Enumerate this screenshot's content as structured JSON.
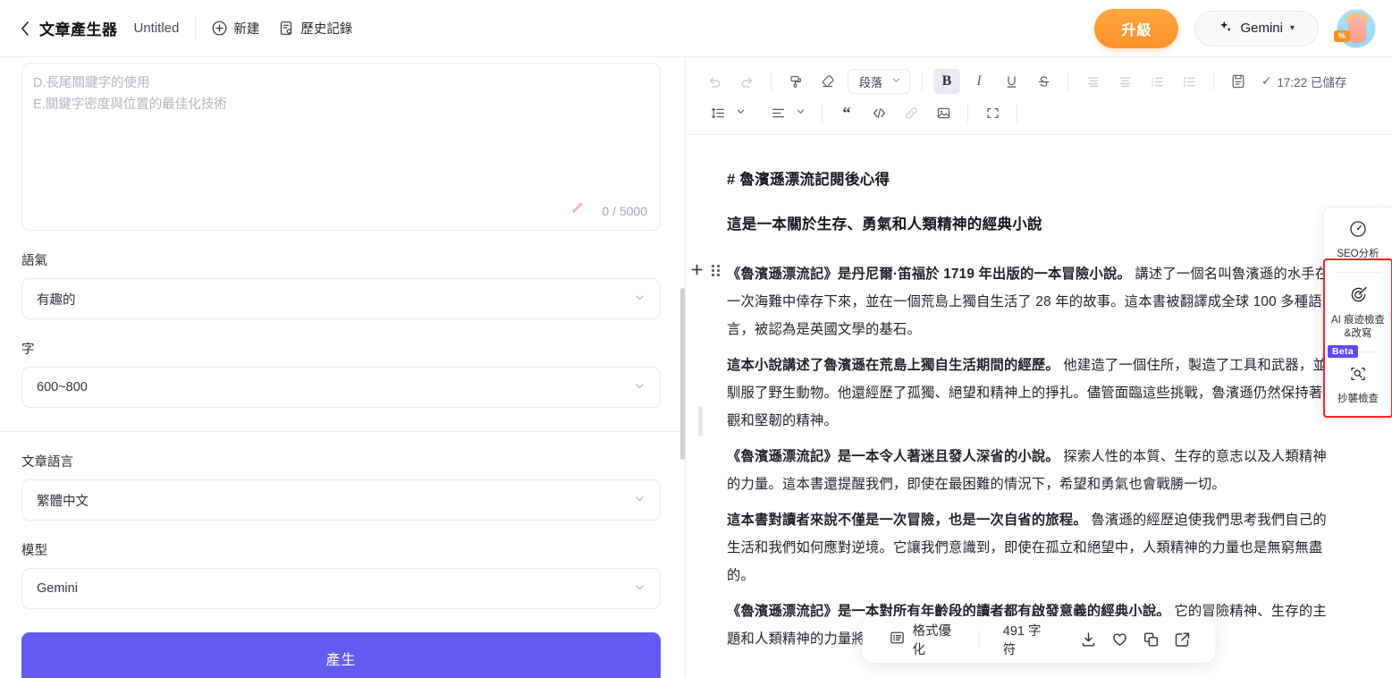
{
  "topbar": {
    "back_icon": "chevron-left-icon",
    "app_title": "文章產生器",
    "doc_title": "Untitled",
    "new_label": "新建",
    "history_label": "歷史記錄",
    "upgrade_label": "升級",
    "model_label": "Gemini",
    "model_caret": "▾",
    "avatar_badge": "%"
  },
  "left": {
    "prompt_lines": [
      "D.長尾關鍵字的使用",
      "E.關鍵字密度與位置的最佳化技術"
    ],
    "char_count": "0 / 5000",
    "fields": [
      {
        "label": "語氣",
        "value": "有趣的"
      },
      {
        "label": "字",
        "value": "600~800"
      },
      {
        "label": "文章語言",
        "value": "繁體中文"
      },
      {
        "label": "模型",
        "value": "Gemini"
      }
    ],
    "generate_label": "產生"
  },
  "editor": {
    "toolbar_row1": [
      {
        "name": "undo-icon",
        "state": "dim"
      },
      {
        "name": "redo-icon",
        "state": "dim"
      },
      {
        "name": "format-paint-icon",
        "state": "normal"
      },
      {
        "name": "clear-format-icon",
        "state": "normal"
      }
    ],
    "paragraph_select": "段落",
    "paragraph_caret": "⌄",
    "style_buttons": [
      {
        "name": "bold-icon",
        "glyph": "B",
        "active": true
      },
      {
        "name": "italic-icon",
        "glyph": "I",
        "active": false
      },
      {
        "name": "underline-icon",
        "glyph": "U",
        "active": false
      },
      {
        "name": "strikethrough-icon",
        "glyph": "S",
        "active": false
      }
    ],
    "list_buttons": [
      "indent-icon",
      "align-icon",
      "ordered-list-icon",
      "bullet-list-icon"
    ],
    "save_icon": "document-save-icon",
    "saved_check": "✓",
    "saved_text": "17:22 已儲存",
    "toolbar_row2": [
      "line-height-icon",
      "text-align-icon",
      "quote-icon",
      "code-icon",
      "link-icon",
      "image-icon",
      "fullscreen-icon"
    ]
  },
  "document": {
    "heading": "# 魯濱遜漂流記閱後心得",
    "subheading": "這是一本關於生存、勇氣和人類精神的經典小說",
    "paragraphs": [
      {
        "bold": "《魯濱遜漂流記》是丹尼爾·笛福於 1719 年出版的一本冒險小說。",
        "text": " 講述了一個名叫魯濱遜的水手在一次海難中倖存下來，並在一個荒島上獨自生活了 28 年的故事。這本書被翻譯成全球 100 多種語言，被認為是英國文學的基石。"
      },
      {
        "bold": "這本小說講述了魯濱遜在荒島上獨自生活期間的經歷。",
        "text": " 他建造了一個住所，製造了工具和武器，並馴服了野生動物。他還經歷了孤獨、絕望和精神上的掙扎。儘管面臨這些挑戰，魯濱遜仍然保持著樂觀和堅韌的精神。"
      },
      {
        "bold": "《魯濱遜漂流記》是一本令人著迷且發人深省的小說。",
        "text": " 探索人性的本質、生存的意志以及人類精神的力量。這本書還提醒我們，即使在最困難的情況下，希望和勇氣也會戰勝一切。"
      },
      {
        "bold": "這本書對讀者來說不僅是一次冒險，也是一次自省的旅程。",
        "text": " 魯濱遜的經歷迫使我們思考我們自己的生活和我們如何應對逆境。它讓我們意識到，即使在孤立和絕望中，人類精神的力量也是無窮無盡的。"
      },
      {
        "bold": "《魯濱遜漂流記》是一本對所有年齡段的讀者都有啟發意義的經典小說。",
        "text": " 它的冒險精神、生存的主題和人類精神的力量將繼續激勵和鼓舞讀者幾代人。它是文學史上必讀的一書。"
      }
    ]
  },
  "side_panel": {
    "items": [
      {
        "icon": "speedometer-icon",
        "label": "SEO分析",
        "badge": ""
      },
      {
        "icon": "ai-trace-icon",
        "label": "AI 痕迹檢查\n&改寫",
        "badge": ""
      },
      {
        "icon": "plagiarism-icon",
        "label": "抄襲檢查",
        "badge": "Beta"
      }
    ],
    "highlight_color": "#ff2020"
  },
  "bottom_bar": {
    "format_label": "格式優化",
    "char_count": "491 字符",
    "actions": [
      "download-icon",
      "heart-icon",
      "copy-icon",
      "export-icon"
    ]
  },
  "colors": {
    "accent": "#6359f3",
    "upgrade": "#fb922b",
    "beta": "#5b4bf5",
    "highlight": "#ff2020"
  }
}
